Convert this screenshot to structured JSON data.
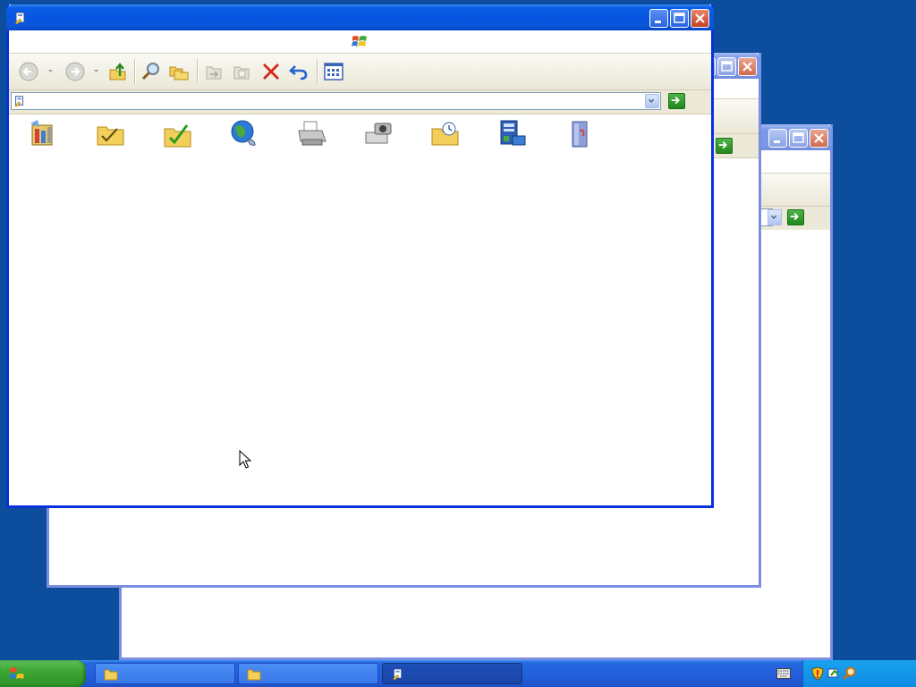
{
  "windows": [
    {
      "id": "back",
      "title": "",
      "state": "inactive"
    },
    {
      "id": "middle",
      "title": "",
      "state": "inactive"
    },
    {
      "id": "front",
      "title": "",
      "state": "active"
    }
  ],
  "front_window": {
    "address": {
      "value": ""
    },
    "toolbar": [
      "back-icon",
      "forward-icon",
      "up-folder-icon",
      "search-icon",
      "folders-icon",
      "move-to-icon",
      "copy-to-icon",
      "delete-icon",
      "undo-icon",
      "views-icon"
    ],
    "content_icons": [
      "control-panel-icon",
      "my-documents-icon",
      "shared-folder-icon",
      "network-icon",
      "printer-icon",
      "scanner-camera-icon",
      "recent-folder-icon",
      "system-icon",
      "recycle-icon"
    ]
  },
  "taskbar": {
    "buttons": [
      {
        "label": "",
        "icon": "folder-icon",
        "active": false
      },
      {
        "label": "",
        "icon": "folder-icon",
        "active": false
      },
      {
        "label": "",
        "icon": "window-icon",
        "active": true
      }
    ],
    "tray_icons": [
      "keyboard-icon",
      "security-shield-icon",
      "network-status-icon",
      "search-tray-icon"
    ],
    "clock": ""
  },
  "colors": {
    "desktop": "#0d4d9d",
    "titlebar_active": "#0755e0",
    "start_button": "#3da634",
    "tray": "#0f8be2"
  }
}
